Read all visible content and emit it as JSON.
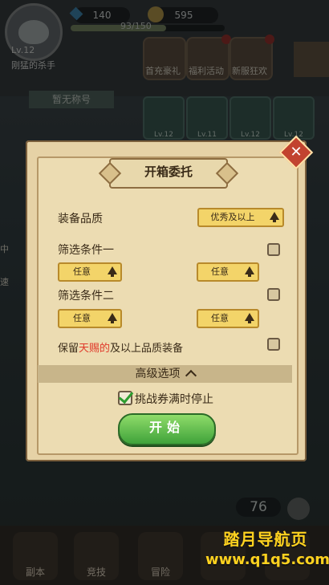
{
  "player": {
    "level": "Lv.12",
    "name": "刚猛的杀手"
  },
  "resources": {
    "gems": "140",
    "gold": "595",
    "xp": "93/150"
  },
  "top_tiles": [
    {
      "label": "首充豪礼"
    },
    {
      "label": "福利活动"
    },
    {
      "label": "新服狂欢"
    }
  ],
  "title_ribbon": "暂无称号",
  "equipment": [
    {
      "level": "Lv.12"
    },
    {
      "level": "Lv.11"
    },
    {
      "level": "Lv.12"
    },
    {
      "level": "Lv.12"
    }
  ],
  "side": {
    "a": "中",
    "b": "速"
  },
  "counter": "76",
  "bottom_nav": [
    {
      "label": "副本"
    },
    {
      "label": "竞技"
    },
    {
      "label": "冒险"
    },
    {
      "label": ""
    },
    {
      "label": ""
    }
  ],
  "dialog": {
    "title": "开箱委托",
    "close_symbol": "✕",
    "quality_label": "装备品质",
    "quality_value": "优秀及以上",
    "filter1_label": "筛选条件一",
    "filter1_a": "任意",
    "filter1_b": "任意",
    "filter2_label": "筛选条件二",
    "filter2_a": "任意",
    "filter2_b": "任意",
    "keep_prefix": "保留",
    "keep_highlight": "天赐的",
    "keep_suffix": "及以上品质装备",
    "advanced": "高级选项",
    "stop_label": "挑战券满时停止",
    "start": "开始"
  },
  "watermark": {
    "line1": "踏月导航页",
    "line2": "www.q1q5.com"
  },
  "colors": {
    "highlight": "#e0392a",
    "button_green": "#3fa23a",
    "select_yellow": "#f3d469",
    "watermark": "#ffd21f"
  }
}
